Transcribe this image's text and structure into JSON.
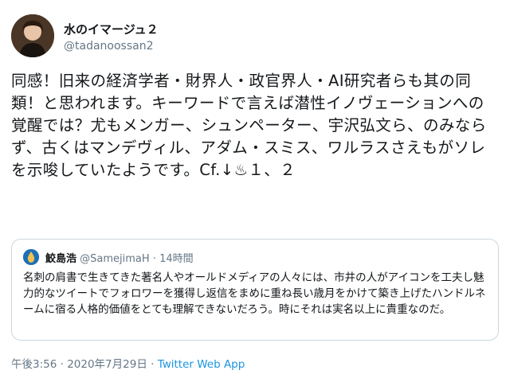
{
  "user": {
    "display_name": "水のイマージュ２",
    "handle": "@tadanoossan2"
  },
  "tweet": {
    "text": "同感！旧来の経済学者・財界人・政官界人・AI研究者らも其の同類！と思われます。キーワードで言えば潜性イノヴェーションへの覚醒では？尤もメンガー、シュンペーター、宇沢弘文ら、のみならず、古くはマンデヴィル、アダム・スミス、ワルラスさえもがソレを示唆していたようです。Cf.↓♨１、２"
  },
  "quoted_tweet": {
    "name": "鮫島浩",
    "handle": "@SamejimaH",
    "separator": "·",
    "time": "14時間",
    "text": "名刺の肩書で生きてきた著名人やオールドメディアの人々には、市井の人がアイコンを工夫し魅力的なツイートでフォロワーを獲得し返信をまめに重ね長い歳月をかけて築き上げたハンドルネームに宿る人格的価値をとても理解できないだろう。時にそれは実名以上に貴重なのだ。"
  },
  "footer": {
    "timestamp": "午後3:56 · 2020年7月29日 · ",
    "source": "Twitter Web App"
  },
  "colors": {
    "text": "#14171a",
    "secondary": "#657786",
    "link": "#1b95e0",
    "border": "#ccd6dd"
  }
}
